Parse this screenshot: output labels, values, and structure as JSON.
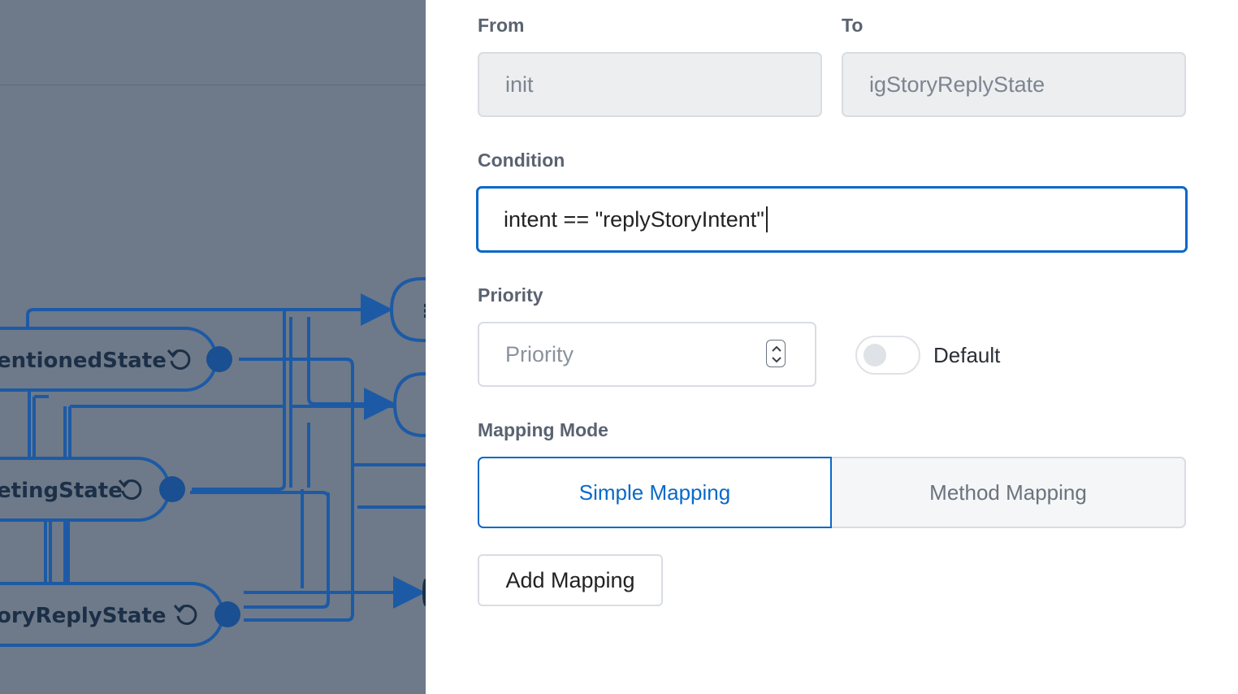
{
  "canvas": {
    "nodes": [
      {
        "label": "entionedState",
        "icon": "reset-icon"
      },
      {
        "label": "etingState",
        "icon": "reset-icon"
      },
      {
        "label": "oryReplyState",
        "icon": "reset-icon"
      }
    ],
    "partial_node_glyph": "⋮"
  },
  "form": {
    "from": {
      "label": "From",
      "value": "init"
    },
    "to": {
      "label": "To",
      "value": "igStoryReplyState"
    },
    "condition": {
      "label": "Condition",
      "value": "intent == \"replyStoryIntent\""
    },
    "priority": {
      "label": "Priority",
      "placeholder": "Priority",
      "stepper_icon": "stepper-icon"
    },
    "default_toggle": {
      "label": "Default",
      "on": false
    },
    "mapping_mode": {
      "label": "Mapping Mode",
      "options": [
        "Simple Mapping",
        "Method Mapping"
      ],
      "selected": "Simple Mapping"
    },
    "add_mapping_label": "Add Mapping"
  },
  "colors": {
    "accent": "#0a68c9",
    "canvas_overlay": "#6e7a89",
    "diagram_line": "#1d5aa6"
  }
}
